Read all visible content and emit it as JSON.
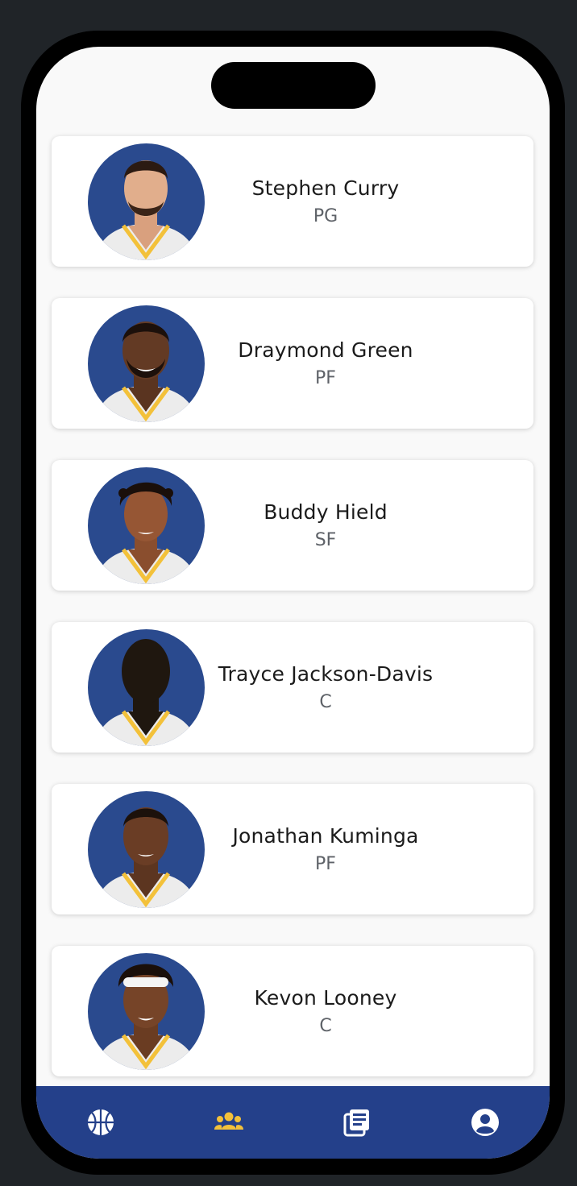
{
  "players": [
    {
      "name": "Stephen Curry",
      "position": "PG"
    },
    {
      "name": "Draymond Green",
      "position": "PF"
    },
    {
      "name": "Buddy Hield",
      "position": "SF"
    },
    {
      "name": "Trayce Jackson-Davis",
      "position": "C"
    },
    {
      "name": "Jonathan Kuminga",
      "position": "PF"
    },
    {
      "name": "Kevon Looney",
      "position": "C"
    }
  ],
  "tabbar": {
    "tabs": [
      {
        "icon": "basketball-icon",
        "active": false
      },
      {
        "icon": "team-icon",
        "active": true
      },
      {
        "icon": "news-icon",
        "active": false
      },
      {
        "icon": "profile-icon",
        "active": false
      }
    ]
  },
  "colors": {
    "accent": "#f3c13a",
    "tabbar_bg": "#24408a",
    "avatar_bg": "#2a4a8e",
    "background": "#f9f9f9",
    "frame": "#202428"
  }
}
